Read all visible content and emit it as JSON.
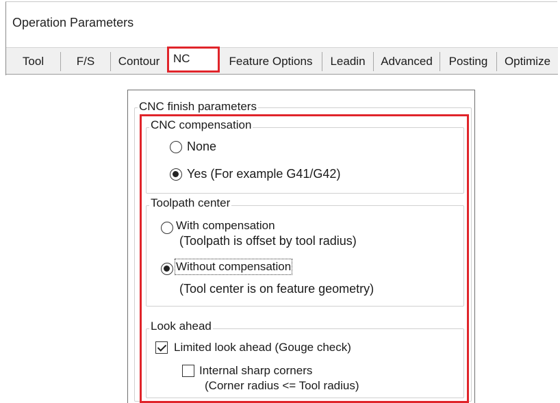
{
  "window": {
    "title": "Operation Parameters"
  },
  "tabs": [
    {
      "label": "Tool"
    },
    {
      "label": "F/S"
    },
    {
      "label": "Contour"
    },
    {
      "label": "NC",
      "active": true
    },
    {
      "label": "Feature Options"
    },
    {
      "label": "Leadin"
    },
    {
      "label": "Advanced"
    },
    {
      "label": "Posting"
    },
    {
      "label": "Optimize"
    }
  ],
  "panel": {
    "title": "CNC finish parameters",
    "cnc_compensation": {
      "legend": "CNC compensation",
      "options": [
        {
          "label": "None",
          "selected": false
        },
        {
          "label": "Yes (For example G41/G42)",
          "selected": true
        }
      ]
    },
    "toolpath_center": {
      "legend": "Toolpath center",
      "options": [
        {
          "label": "With compensation",
          "sublabel": "(Toolpath is offset by tool radius)",
          "selected": false
        },
        {
          "label": "Without compensation",
          "sublabel": "(Tool center is on feature geometry)",
          "selected": true
        }
      ]
    },
    "look_ahead": {
      "legend": "Look ahead",
      "limited": {
        "label": "Limited look ahead (Gouge check)",
        "checked": true
      },
      "internal": {
        "label": "Internal sharp corners",
        "sublabel": "(Corner radius <= Tool radius)",
        "checked": false
      }
    }
  },
  "colors": {
    "highlight": "#e0242a"
  }
}
